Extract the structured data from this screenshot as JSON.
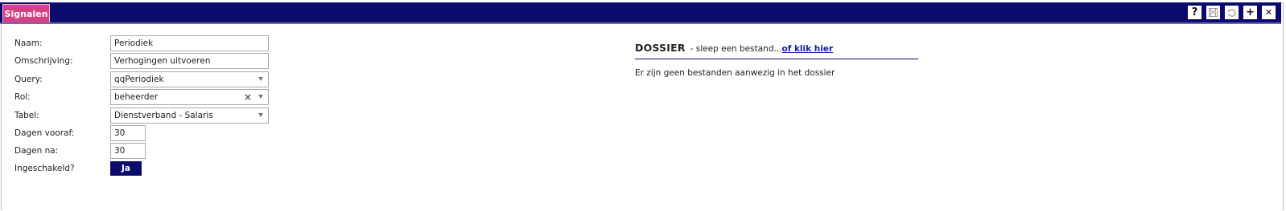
{
  "tab": {
    "label": "Signalen"
  },
  "toolbar": {
    "help_label": "?",
    "add_label": "+",
    "close_label": "✕"
  },
  "form": {
    "naam": {
      "label": "Naam:",
      "value": "Periodiek"
    },
    "omschrijving": {
      "label": "Omschrijving:",
      "value": "Verhogingen uitvoeren"
    },
    "query": {
      "label": "Query:",
      "value": "qqPeriodiek"
    },
    "rol": {
      "label": "Rol:",
      "value": "beheerder",
      "clear": "×"
    },
    "tabel": {
      "label": "Tabel:",
      "value": "Dienstverband - Salaris"
    },
    "dagen_vooraf": {
      "label": "Dagen vooraf:",
      "value": "30"
    },
    "dagen_na": {
      "label": "Dagen na:",
      "value": "30"
    },
    "ingeschakeld": {
      "label": "Ingeschakeld?",
      "value": "Ja"
    }
  },
  "dossier": {
    "title": "DOSSIER",
    "subtitle": "- sleep een bestand...",
    "link": "of klik hier",
    "empty_text": "Er zijn geen bestanden aanwezig in het dossier"
  },
  "colors": {
    "header_bg": "#0b0b6e",
    "tab_bg": "#d64084",
    "toggle_bg": "#0b0b6e",
    "link": "#1a1aa6"
  },
  "icons": [
    "help-icon",
    "save-icon",
    "undo-icon",
    "add-icon",
    "close-icon",
    "chevron-down-icon",
    "clear-icon"
  ]
}
